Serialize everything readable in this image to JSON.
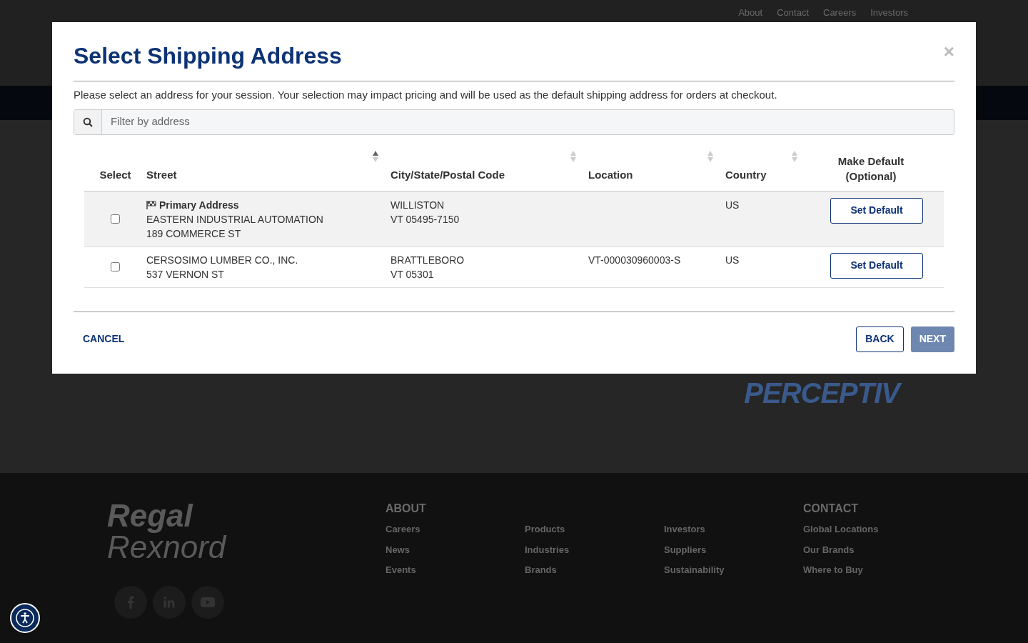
{
  "background": {
    "top_nav": [
      "About",
      "Contact",
      "Careers",
      "Investors"
    ],
    "brand_banner": "PERCEPTIV",
    "footer": {
      "logo": [
        "Regal",
        "Rexnord"
      ],
      "columns": [
        {
          "heading": "ABOUT",
          "links": [
            "Careers",
            "News",
            "Events"
          ]
        },
        {
          "links": [
            "Products",
            "Industries",
            "Brands"
          ]
        },
        {
          "links": [
            "Investors",
            "Suppliers",
            "Sustainability"
          ]
        },
        {
          "heading": "CONTACT",
          "links": [
            "Global Locations",
            "Our Brands",
            "Where to Buy"
          ]
        }
      ]
    }
  },
  "modal": {
    "title": "Select Shipping Address",
    "close": "×",
    "intro": "Please select an address for your session. Your selection may impact pricing and will be used as the default shipping address for orders at checkout.",
    "search": {
      "placeholder": "Filter by address"
    },
    "table": {
      "columns": [
        {
          "label": "Select"
        },
        {
          "label": "Street",
          "sortable": true,
          "sorted": true
        },
        {
          "label": "City/State/Postal Code",
          "sortable": true,
          "sorted": false
        },
        {
          "label": "Location",
          "sortable": true,
          "sorted": false
        },
        {
          "label": "Country",
          "sortable": true,
          "sorted": false
        },
        {
          "label": "Make Default (Optional)"
        }
      ],
      "rows": [
        {
          "highlighted": true,
          "checked": false,
          "badge": "Primary Address",
          "street": [
            "EASTERN INDUSTRIAL AUTOMATION",
            "189 COMMERCE ST"
          ],
          "city": [
            "WILLISTON",
            "VT 05495-7150"
          ],
          "country": "US",
          "action": "Set Default"
        },
        {
          "highlighted": false,
          "checked": false,
          "street": [
            "CERSOSIMO LUMBER CO., INC.",
            "537 VERNON ST"
          ],
          "city": [
            "BRATTLEBORO",
            "VT 05301"
          ],
          "location": "VT-000030960003-S",
          "country": "US",
          "action": "Set Default"
        }
      ]
    },
    "footer": {
      "cancel": "CANCEL",
      "back": "BACK",
      "next": {
        "label": "NEXT",
        "disabled": true
      }
    }
  }
}
